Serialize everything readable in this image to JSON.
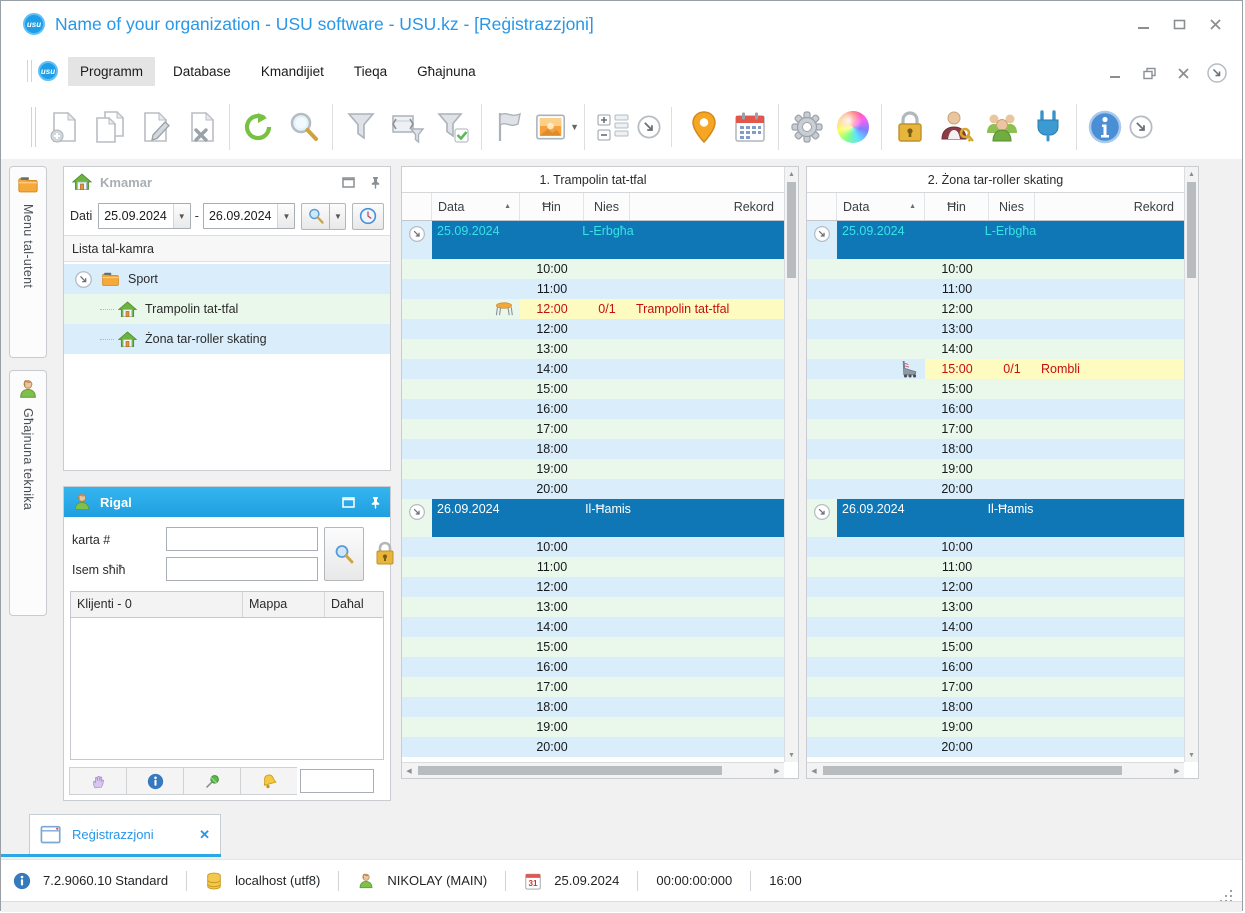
{
  "colors": {
    "accent_blue": "#2797e8",
    "row_blue": "#d9edfb",
    "row_green": "#e9f8ea",
    "booking_yellow": "#fdfbc0",
    "booking_red": "#c60f0f",
    "date_header_bg": "#1077b7",
    "date_selected_text": "#37e3e3",
    "rigal_header_bg": "#2aace8"
  },
  "title_bar": {
    "app_title": "Name of your organization - USU software - USU.kz - [Reġistrazzjoni]"
  },
  "menu": {
    "items": [
      "Programm",
      "Database",
      "Kmandijiet",
      "Tieqa",
      "Għajnuna"
    ],
    "active_index": 0
  },
  "toolbar": {
    "groups": [
      [
        {
          "name": "add-record-button",
          "icon": "doc-add-icon"
        },
        {
          "name": "copy-record-button",
          "icon": "doc-copy-icon"
        },
        {
          "name": "edit-record-button",
          "icon": "doc-edit-icon"
        },
        {
          "name": "delete-record-button",
          "icon": "doc-delete-icon"
        }
      ],
      [
        {
          "name": "refresh-button",
          "icon": "refresh-icon"
        },
        {
          "name": "search-button",
          "icon": "search-icon"
        }
      ],
      [
        {
          "name": "filter-button",
          "icon": "funnel-icon"
        },
        {
          "name": "filter-columns-button",
          "icon": "funnel-columns-icon"
        },
        {
          "name": "filter-apply-button",
          "icon": "funnel-check-icon"
        }
      ],
      [
        {
          "name": "flag-button",
          "icon": "flag-icon"
        },
        {
          "name": "image-button",
          "icon": "image-icon",
          "caret": true
        }
      ],
      [
        {
          "name": "expand-rows-button",
          "icon": "rows-expand-icon"
        },
        {
          "name": "toolbar-overflow-button",
          "icon": "expand-circle-icon",
          "plain": true
        }
      ],
      [
        {
          "name": "location-button",
          "icon": "map-pin-icon"
        },
        {
          "name": "calendar-button",
          "icon": "calendar-icon"
        }
      ],
      [
        {
          "name": "settings-button",
          "icon": "gear-icon"
        },
        {
          "name": "colors-button",
          "icon": "color-sphere-icon"
        }
      ],
      [
        {
          "name": "lock-button",
          "icon": "lock-icon"
        },
        {
          "name": "user-key-button",
          "icon": "user-key-icon"
        },
        {
          "name": "users-button",
          "icon": "users-icon"
        },
        {
          "name": "plug-button",
          "icon": "plug-icon"
        }
      ],
      [
        {
          "name": "info-button",
          "icon": "info-circle-icon"
        },
        {
          "name": "toolbar-overflow-button-2",
          "icon": "expand-circle-icon",
          "plain": true
        }
      ]
    ]
  },
  "side_tabs": [
    {
      "label": "Menu tal-utent",
      "icon": "folder-icon"
    },
    {
      "label": "Għajnuna teknika",
      "icon": "person-icon"
    }
  ],
  "kmamar": {
    "title": "Kmamar",
    "date_label": "Dati",
    "date_from": "25.09.2024",
    "date_separator": "-",
    "date_to": "26.09.2024",
    "list_header": "Lista tal-kamra",
    "tree": [
      {
        "label": "Sport",
        "type": "folder",
        "shade": "blue",
        "expandable": true
      },
      {
        "label": "Trampolin tat-tfal",
        "type": "room",
        "shade": "green"
      },
      {
        "label": "Żona tar-roller skating",
        "type": "room",
        "shade": "blue"
      }
    ]
  },
  "rigal": {
    "title": "Rigal",
    "card_label": "karta #",
    "card_value": "",
    "name_label": "Isem sħiħ",
    "name_value": "",
    "table_headers": [
      "Klijenti - 0",
      "Mappa",
      "Daħal"
    ],
    "bottom_buttons": [
      {
        "name": "drag-hand-button",
        "icon": "hand-icon"
      },
      {
        "name": "client-info-button",
        "icon": "info-small-icon"
      },
      {
        "name": "pin-client-button",
        "icon": "pushpin-green-icon"
      },
      {
        "name": "notify-button",
        "icon": "bell-icon"
      }
    ]
  },
  "schedule_panels": [
    {
      "title": "1. Trampolin tat-tfal",
      "columns": {
        "data": "Data",
        "hin": "Ħin",
        "nies": "Nies",
        "rekord": "Rekord"
      },
      "sections": [
        {
          "date": "25.09.2024",
          "day": "L-Erbgħa",
          "selected": true,
          "rows": [
            {
              "time": "10:00"
            },
            {
              "time": "11:00"
            },
            {
              "time": "12:00",
              "people": "0/1",
              "record": "Trampolin tat-tfal",
              "icon": "trampoline-icon"
            },
            {
              "time": "12:00"
            },
            {
              "time": "13:00"
            },
            {
              "time": "14:00"
            },
            {
              "time": "15:00"
            },
            {
              "time": "16:00"
            },
            {
              "time": "17:00"
            },
            {
              "time": "18:00"
            },
            {
              "time": "19:00"
            },
            {
              "time": "20:00"
            }
          ]
        },
        {
          "date": "26.09.2024",
          "day": "Il-Ħamis",
          "selected": false,
          "rows": [
            {
              "time": "10:00"
            },
            {
              "time": "11:00"
            },
            {
              "time": "12:00"
            },
            {
              "time": "13:00"
            },
            {
              "time": "14:00"
            },
            {
              "time": "15:00"
            },
            {
              "time": "16:00"
            },
            {
              "time": "17:00"
            },
            {
              "time": "18:00"
            },
            {
              "time": "19:00"
            },
            {
              "time": "20:00"
            }
          ]
        }
      ]
    },
    {
      "title": "2. Żona tar-roller skating",
      "columns": {
        "data": "Data",
        "hin": "Ħin",
        "nies": "Nies",
        "rekord": "Rekord"
      },
      "sections": [
        {
          "date": "25.09.2024",
          "day": "L-Erbgħa",
          "selected": true,
          "rows": [
            {
              "time": "10:00"
            },
            {
              "time": "11:00"
            },
            {
              "time": "12:00"
            },
            {
              "time": "13:00"
            },
            {
              "time": "14:00"
            },
            {
              "time": "15:00",
              "people": "0/1",
              "record": "Rombli",
              "icon": "roller-skate-icon"
            },
            {
              "time": "15:00"
            },
            {
              "time": "16:00"
            },
            {
              "time": "17:00"
            },
            {
              "time": "18:00"
            },
            {
              "time": "19:00"
            },
            {
              "time": "20:00"
            }
          ]
        },
        {
          "date": "26.09.2024",
          "day": "Il-Ħamis",
          "selected": false,
          "rows": [
            {
              "time": "10:00"
            },
            {
              "time": "11:00"
            },
            {
              "time": "12:00"
            },
            {
              "time": "13:00"
            },
            {
              "time": "14:00"
            },
            {
              "time": "15:00"
            },
            {
              "time": "16:00"
            },
            {
              "time": "17:00"
            },
            {
              "time": "18:00"
            },
            {
              "time": "19:00"
            },
            {
              "time": "20:00"
            }
          ]
        }
      ]
    }
  ],
  "bottom_tab": {
    "label": "Reġistrazzjoni"
  },
  "status_bar": {
    "items": [
      {
        "icon": "info-small-icon",
        "label": "7.2.9060.10 Standard",
        "name": "version-info"
      },
      {
        "icon": "database-icon",
        "label": "localhost (utf8)",
        "name": "database-host"
      },
      {
        "icon": "person-icon",
        "label": "NIKOLAY (MAIN)",
        "name": "current-user"
      },
      {
        "icon": "calendar-31-icon",
        "label": "25.09.2024",
        "name": "current-date"
      },
      {
        "icon": "",
        "label": "00:00:00:000",
        "name": "timer"
      },
      {
        "icon": "",
        "label": "16:00",
        "name": "current-time"
      }
    ]
  }
}
